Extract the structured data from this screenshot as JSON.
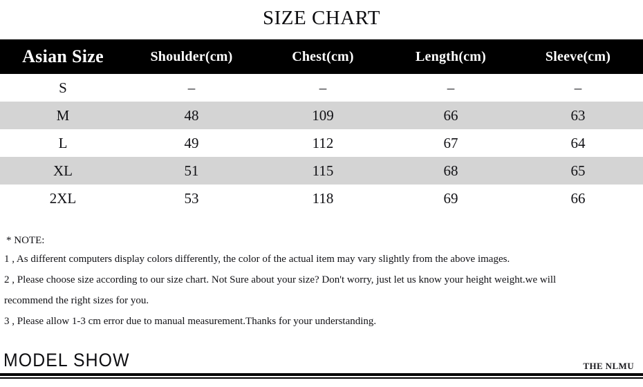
{
  "title": "SIZE CHART",
  "table": {
    "headers": [
      "Asian Size",
      "Shoulder(cm)",
      "Chest(cm)",
      "Length(cm)",
      "Sleeve(cm)"
    ],
    "rows": [
      {
        "size": "S",
        "shoulder": "–",
        "chest": "–",
        "length": "–",
        "sleeve": "–",
        "shaded": false
      },
      {
        "size": "M",
        "shoulder": "48",
        "chest": "109",
        "length": "66",
        "sleeve": "63",
        "shaded": true
      },
      {
        "size": "L",
        "shoulder": "49",
        "chest": "112",
        "length": "67",
        "sleeve": "64",
        "shaded": false
      },
      {
        "size": "XL",
        "shoulder": "51",
        "chest": "115",
        "length": "68",
        "sleeve": "65",
        "shaded": true
      },
      {
        "size": "2XL",
        "shoulder": "53",
        "chest": "118",
        "length": "69",
        "sleeve": "66",
        "shaded": false
      }
    ]
  },
  "notes": {
    "heading": "* NOTE:",
    "line1": "1 , As different computers display colors differently, the color of the actual item may vary slightly from the above images.",
    "line2a": "2 , Please choose size according to our size chart. Not Sure about your size? Don't worry, just let us know your height weight.we will",
    "line2b": "recommend the right sizes for you.",
    "line3": "3 , Please allow 1-3 cm error due to manual measurement.Thanks for your understanding."
  },
  "footer": {
    "model_show": "MODEL SHOW",
    "watermark": "THE NLMU"
  },
  "colors": {
    "header_background": "#000000",
    "header_text": "#ffffff",
    "shaded_row": "#d4d4d4",
    "plain_row": "#ffffff",
    "body_text": "#111115"
  }
}
